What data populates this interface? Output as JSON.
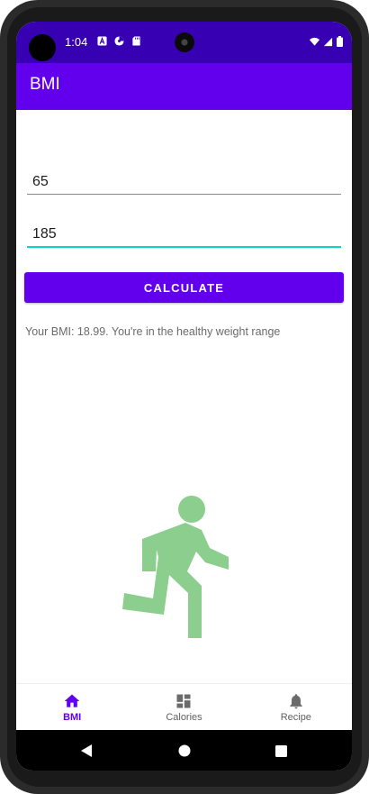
{
  "status_bar": {
    "time": "1:04",
    "icons_left": [
      "a-notification-icon",
      "data-saver-icon",
      "sd-card-icon"
    ],
    "icons_right": [
      "wifi-icon",
      "signal-icon",
      "battery-icon"
    ]
  },
  "app_bar": {
    "title": "BMI"
  },
  "form": {
    "weight_value": "65",
    "height_value": "185",
    "calculate_label": "CALCULATE"
  },
  "result": {
    "text": "Your BMI: 18.99. You're in the healthy weight range"
  },
  "illustration": {
    "icon": "running-person-icon",
    "color": "#8BCE8D"
  },
  "bottom_nav": {
    "items": [
      {
        "label": "BMI",
        "icon": "home-icon",
        "active": true
      },
      {
        "label": "Calories",
        "icon": "dashboard-icon",
        "active": false
      },
      {
        "label": "Recipe",
        "icon": "bell-icon",
        "active": false
      }
    ]
  },
  "colors": {
    "primary": "#6200EE",
    "primary_dark": "#3700B3",
    "accent": "#03DAC5"
  }
}
